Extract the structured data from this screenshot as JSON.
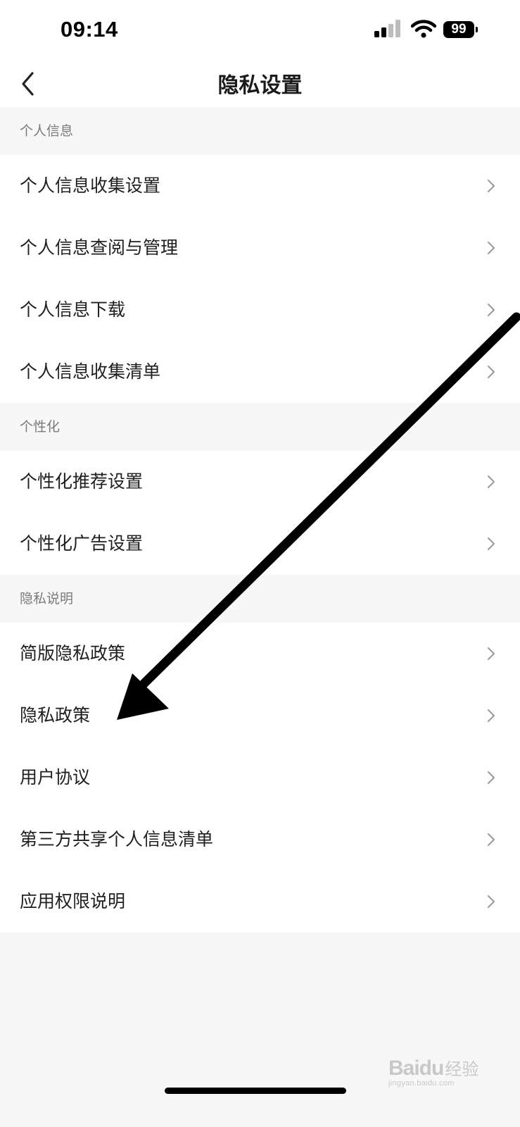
{
  "status_bar": {
    "time": "09:14",
    "battery_level": "99"
  },
  "nav": {
    "title": "隐私设置",
    "back_icon": "chevron-left-icon"
  },
  "sections": [
    {
      "header": "个人信息",
      "items": [
        {
          "label": "个人信息收集设置"
        },
        {
          "label": "个人信息查阅与管理"
        },
        {
          "label": "个人信息下载"
        },
        {
          "label": "个人信息收集清单"
        }
      ]
    },
    {
      "header": "个性化",
      "items": [
        {
          "label": "个性化推荐设置"
        },
        {
          "label": "个性化广告设置"
        }
      ]
    },
    {
      "header": "隐私说明",
      "items": [
        {
          "label": "简版隐私政策"
        },
        {
          "label": "隐私政策"
        },
        {
          "label": "用户协议"
        },
        {
          "label": "第三方共享个人信息清单"
        },
        {
          "label": "应用权限说明"
        }
      ]
    }
  ],
  "watermark": {
    "logo": "Baidu",
    "logo_cn": "经验",
    "url": "jingyan.baidu.com"
  },
  "colors": {
    "background": "#f7f7f7",
    "row_background": "#ffffff",
    "section_header_text": "#7a7a7a",
    "annotation_arrow": "#000000"
  }
}
